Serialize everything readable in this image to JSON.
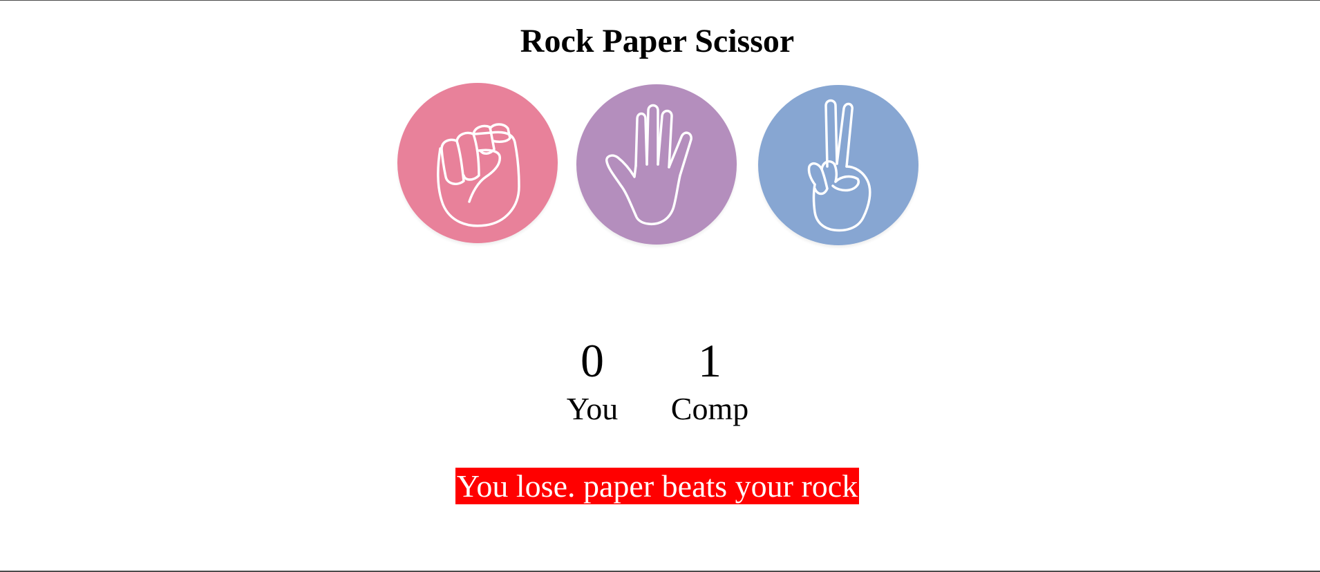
{
  "game": {
    "title": "Rock Paper Scissor"
  },
  "choices": [
    {
      "name": "rock",
      "icon": "fist-icon",
      "color": "#e8819a"
    },
    {
      "name": "paper",
      "icon": "open-hand-icon",
      "color": "#b48ebd"
    },
    {
      "name": "scissors",
      "icon": "peace-hand-icon",
      "color": "#87a6d2"
    }
  ],
  "scoreboard": {
    "user_score": "0",
    "user_label": "You",
    "comp_score": "1",
    "comp_label": "Comp"
  },
  "message": {
    "text": "You lose. paper beats your rock",
    "background": "#ff0000",
    "color": "#ffffff"
  }
}
